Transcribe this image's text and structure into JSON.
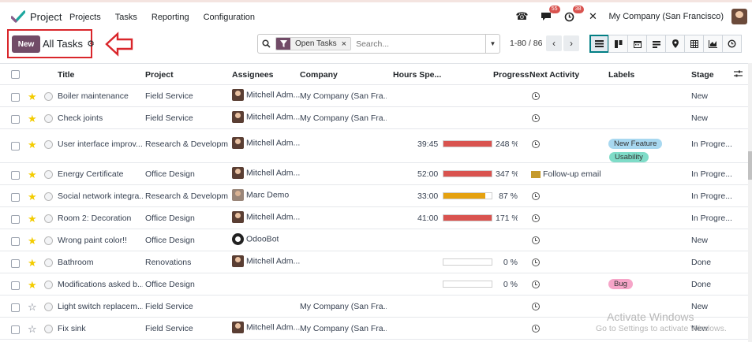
{
  "navbar": {
    "app_name": "Project",
    "menu": [
      "Projects",
      "Tasks",
      "Reporting",
      "Configuration"
    ],
    "messages_count": "55",
    "activities_count": "38",
    "company": "My Company (San Francisco)"
  },
  "control": {
    "new_label": "New",
    "view_title": "All Tasks",
    "search": {
      "facet": "Open Tasks",
      "placeholder": "Search..."
    },
    "pager": "1-80 / 86",
    "views": [
      "list-icon",
      "kanban-icon",
      "calendar-icon",
      "pivot-icon",
      "map-icon",
      "spreadsheet-icon",
      "graph-icon",
      "activity-icon"
    ]
  },
  "table": {
    "headers": {
      "title": "Title",
      "project": "Project",
      "assignees": "Assignees",
      "company": "Company",
      "hours": "Hours Spe...",
      "progress": "Progress",
      "activity": "Next Activity",
      "labels": "Labels",
      "stage": "Stage"
    },
    "rows": [
      {
        "starred": true,
        "title": "Boiler maintenance",
        "project": "Field Service",
        "assignee": "Mitchell Adm...",
        "avatar": "mitchell",
        "company": "My Company (San Fra...",
        "hours": "",
        "progress": null,
        "progress_text": "",
        "activity": "",
        "labels": [],
        "stage": "New"
      },
      {
        "starred": true,
        "title": "Check joints",
        "project": "Field Service",
        "assignee": "Mitchell Adm...",
        "avatar": "mitchell",
        "company": "My Company (San Fra...",
        "hours": "",
        "progress": null,
        "progress_text": "",
        "activity": "",
        "labels": [],
        "stage": "New"
      },
      {
        "starred": true,
        "title": "User interface improv...",
        "project": "Research & Developm...",
        "assignee": "Mitchell Adm...",
        "avatar": "mitchell",
        "company": "",
        "hours": "39:45",
        "progress": 248,
        "progress_text": "248 %",
        "activity": "",
        "labels": [
          {
            "text": "New Feature",
            "color": "#a8d8f0"
          },
          {
            "text": "Usability",
            "color": "#7fdcc8"
          }
        ],
        "stage": "In Progre..."
      },
      {
        "starred": true,
        "title": "Energy Certificate",
        "project": "Office Design",
        "assignee": "Mitchell Adm...",
        "avatar": "mitchell",
        "company": "",
        "hours": "52:00",
        "progress": 347,
        "progress_text": "347 %",
        "activity": "Follow-up email",
        "labels": [],
        "stage": "In Progre..."
      },
      {
        "starred": true,
        "title": "Social network integra...",
        "project": "Research & Developm...",
        "assignee": "Marc Demo",
        "avatar": "marc",
        "company": "",
        "hours": "33:00",
        "progress": 87,
        "progress_text": "87 %",
        "activity": "",
        "labels": [],
        "stage": "In Progre..."
      },
      {
        "starred": true,
        "title": "Room 2: Decoration",
        "project": "Office Design",
        "assignee": "Mitchell Adm...",
        "avatar": "mitchell",
        "company": "",
        "hours": "41:00",
        "progress": 171,
        "progress_text": "171 %",
        "activity": "",
        "labels": [],
        "stage": "In Progre..."
      },
      {
        "starred": true,
        "title": "Wrong paint color!!",
        "project": "Office Design",
        "assignee": "OdooBot",
        "avatar": "bot",
        "company": "",
        "hours": "",
        "progress": null,
        "progress_text": "",
        "activity": "",
        "labels": [],
        "stage": "New"
      },
      {
        "starred": true,
        "title": "Bathroom",
        "project": "Renovations",
        "assignee": "Mitchell Adm...",
        "avatar": "mitchell",
        "company": "",
        "hours": "",
        "progress": 0,
        "progress_text": "0 %",
        "activity": "",
        "labels": [],
        "stage": "Done"
      },
      {
        "starred": true,
        "title": "Modifications asked b...",
        "project": "Office Design",
        "assignee": "",
        "avatar": "",
        "company": "",
        "hours": "",
        "progress": 0,
        "progress_text": "0 %",
        "activity": "",
        "labels": [
          {
            "text": "Bug",
            "color": "#f6a5c8"
          }
        ],
        "stage": "Done"
      },
      {
        "starred": false,
        "title": "Light switch replacem...",
        "project": "Field Service",
        "assignee": "",
        "avatar": "",
        "company": "My Company (San Fra...",
        "hours": "",
        "progress": null,
        "progress_text": "",
        "activity": "",
        "labels": [],
        "stage": "New"
      },
      {
        "starred": false,
        "title": "Fix sink",
        "project": "Field Service",
        "assignee": "Mitchell Adm...",
        "avatar": "mitchell",
        "company": "My Company (San Fra...",
        "hours": "",
        "progress": null,
        "progress_text": "",
        "activity": "",
        "labels": [],
        "stage": "New"
      }
    ]
  },
  "colors": {
    "brand": "#714b67",
    "bar_red": "#d9534f",
    "bar_orange": "#e5a10f",
    "highlight": "#d9262b"
  },
  "watermark": {
    "line1": "Activate Windows",
    "line2": "Go to Settings to activate Windows."
  }
}
